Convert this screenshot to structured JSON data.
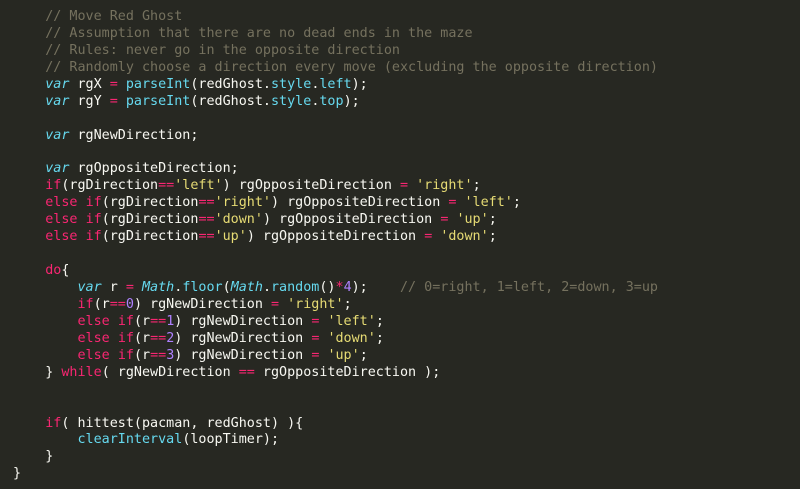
{
  "editor": {
    "theme": {
      "background": "#272822",
      "comment": "#75715e",
      "keyword": "#f92672",
      "storage": "#66d9ef",
      "string": "#e6db74",
      "number": "#ae81ff",
      "plain": "#f8f8f2"
    },
    "lines": [
      [
        {
          "t": "ws",
          "v": "    "
        },
        {
          "t": "comment",
          "v": "// Move Red Ghost"
        }
      ],
      [
        {
          "t": "ws",
          "v": "    "
        },
        {
          "t": "comment",
          "v": "// Assumption that there are no dead ends in the maze"
        }
      ],
      [
        {
          "t": "ws",
          "v": "    "
        },
        {
          "t": "comment",
          "v": "// Rules: never go in the opposite direction"
        }
      ],
      [
        {
          "t": "ws",
          "v": "    "
        },
        {
          "t": "comment",
          "v": "// Randomly choose a direction every move (excluding the opposite direction)"
        }
      ],
      [
        {
          "t": "ws",
          "v": "    "
        },
        {
          "t": "storage",
          "v": "var"
        },
        {
          "t": "plain",
          "v": " rgX "
        },
        {
          "t": "operator",
          "v": "="
        },
        {
          "t": "plain",
          "v": " "
        },
        {
          "t": "func",
          "v": "parseInt"
        },
        {
          "t": "plain",
          "v": "(redGhost."
        },
        {
          "t": "func",
          "v": "style"
        },
        {
          "t": "plain",
          "v": "."
        },
        {
          "t": "func",
          "v": "left"
        },
        {
          "t": "plain",
          "v": ");"
        }
      ],
      [
        {
          "t": "ws",
          "v": "    "
        },
        {
          "t": "storage",
          "v": "var"
        },
        {
          "t": "plain",
          "v": " rgY "
        },
        {
          "t": "operator",
          "v": "="
        },
        {
          "t": "plain",
          "v": " "
        },
        {
          "t": "func",
          "v": "parseInt"
        },
        {
          "t": "plain",
          "v": "(redGhost."
        },
        {
          "t": "func",
          "v": "style"
        },
        {
          "t": "plain",
          "v": "."
        },
        {
          "t": "func",
          "v": "top"
        },
        {
          "t": "plain",
          "v": ");"
        }
      ],
      [],
      [
        {
          "t": "ws",
          "v": "    "
        },
        {
          "t": "storage",
          "v": "var"
        },
        {
          "t": "plain",
          "v": " rgNewDirection;"
        }
      ],
      [],
      [
        {
          "t": "ws",
          "v": "    "
        },
        {
          "t": "storage",
          "v": "var"
        },
        {
          "t": "plain",
          "v": " rgOppositeDirection;"
        }
      ],
      [
        {
          "t": "ws",
          "v": "    "
        },
        {
          "t": "keyword",
          "v": "if"
        },
        {
          "t": "plain",
          "v": "(rgDirection"
        },
        {
          "t": "operator",
          "v": "=="
        },
        {
          "t": "string",
          "v": "'left'"
        },
        {
          "t": "plain",
          "v": ") rgOppositeDirection "
        },
        {
          "t": "operator",
          "v": "="
        },
        {
          "t": "plain",
          "v": " "
        },
        {
          "t": "string",
          "v": "'right'"
        },
        {
          "t": "plain",
          "v": ";"
        }
      ],
      [
        {
          "t": "ws",
          "v": "    "
        },
        {
          "t": "keyword",
          "v": "else"
        },
        {
          "t": "plain",
          "v": " "
        },
        {
          "t": "keyword",
          "v": "if"
        },
        {
          "t": "plain",
          "v": "(rgDirection"
        },
        {
          "t": "operator",
          "v": "=="
        },
        {
          "t": "string",
          "v": "'right'"
        },
        {
          "t": "plain",
          "v": ") rgOppositeDirection "
        },
        {
          "t": "operator",
          "v": "="
        },
        {
          "t": "plain",
          "v": " "
        },
        {
          "t": "string",
          "v": "'left'"
        },
        {
          "t": "plain",
          "v": ";"
        }
      ],
      [
        {
          "t": "ws",
          "v": "    "
        },
        {
          "t": "keyword",
          "v": "else"
        },
        {
          "t": "plain",
          "v": " "
        },
        {
          "t": "keyword",
          "v": "if"
        },
        {
          "t": "plain",
          "v": "(rgDirection"
        },
        {
          "t": "operator",
          "v": "=="
        },
        {
          "t": "string",
          "v": "'down'"
        },
        {
          "t": "plain",
          "v": ") rgOppositeDirection "
        },
        {
          "t": "operator",
          "v": "="
        },
        {
          "t": "plain",
          "v": " "
        },
        {
          "t": "string",
          "v": "'up'"
        },
        {
          "t": "plain",
          "v": ";"
        }
      ],
      [
        {
          "t": "ws",
          "v": "    "
        },
        {
          "t": "keyword",
          "v": "else"
        },
        {
          "t": "plain",
          "v": " "
        },
        {
          "t": "keyword",
          "v": "if"
        },
        {
          "t": "plain",
          "v": "(rgDirection"
        },
        {
          "t": "operator",
          "v": "=="
        },
        {
          "t": "string",
          "v": "'up'"
        },
        {
          "t": "plain",
          "v": ") rgOppositeDirection "
        },
        {
          "t": "operator",
          "v": "="
        },
        {
          "t": "plain",
          "v": " "
        },
        {
          "t": "string",
          "v": "'down'"
        },
        {
          "t": "plain",
          "v": ";"
        }
      ],
      [],
      [
        {
          "t": "ws",
          "v": "    "
        },
        {
          "t": "keyword",
          "v": "do"
        },
        {
          "t": "plain",
          "v": "{"
        }
      ],
      [
        {
          "t": "ws",
          "v": "        "
        },
        {
          "t": "storage",
          "v": "var"
        },
        {
          "t": "plain",
          "v": " r "
        },
        {
          "t": "operator",
          "v": "="
        },
        {
          "t": "plain",
          "v": " "
        },
        {
          "t": "builtin",
          "v": "Math"
        },
        {
          "t": "plain",
          "v": "."
        },
        {
          "t": "func",
          "v": "floor"
        },
        {
          "t": "plain",
          "v": "("
        },
        {
          "t": "builtin",
          "v": "Math"
        },
        {
          "t": "plain",
          "v": "."
        },
        {
          "t": "func",
          "v": "random"
        },
        {
          "t": "plain",
          "v": "()"
        },
        {
          "t": "operator",
          "v": "*"
        },
        {
          "t": "number",
          "v": "4"
        },
        {
          "t": "plain",
          "v": ");    "
        },
        {
          "t": "comment",
          "v": "// 0=right, 1=left, 2=down, 3=up"
        }
      ],
      [
        {
          "t": "ws",
          "v": "        "
        },
        {
          "t": "keyword",
          "v": "if"
        },
        {
          "t": "plain",
          "v": "(r"
        },
        {
          "t": "operator",
          "v": "=="
        },
        {
          "t": "number",
          "v": "0"
        },
        {
          "t": "plain",
          "v": ") rgNewDirection "
        },
        {
          "t": "operator",
          "v": "="
        },
        {
          "t": "plain",
          "v": " "
        },
        {
          "t": "string",
          "v": "'right'"
        },
        {
          "t": "plain",
          "v": ";"
        }
      ],
      [
        {
          "t": "ws",
          "v": "        "
        },
        {
          "t": "keyword",
          "v": "else"
        },
        {
          "t": "plain",
          "v": " "
        },
        {
          "t": "keyword",
          "v": "if"
        },
        {
          "t": "plain",
          "v": "(r"
        },
        {
          "t": "operator",
          "v": "=="
        },
        {
          "t": "number",
          "v": "1"
        },
        {
          "t": "plain",
          "v": ") rgNewDirection "
        },
        {
          "t": "operator",
          "v": "="
        },
        {
          "t": "plain",
          "v": " "
        },
        {
          "t": "string",
          "v": "'left'"
        },
        {
          "t": "plain",
          "v": ";"
        }
      ],
      [
        {
          "t": "ws",
          "v": "        "
        },
        {
          "t": "keyword",
          "v": "else"
        },
        {
          "t": "plain",
          "v": " "
        },
        {
          "t": "keyword",
          "v": "if"
        },
        {
          "t": "plain",
          "v": "(r"
        },
        {
          "t": "operator",
          "v": "=="
        },
        {
          "t": "number",
          "v": "2"
        },
        {
          "t": "plain",
          "v": ") rgNewDirection "
        },
        {
          "t": "operator",
          "v": "="
        },
        {
          "t": "plain",
          "v": " "
        },
        {
          "t": "string",
          "v": "'down'"
        },
        {
          "t": "plain",
          "v": ";"
        }
      ],
      [
        {
          "t": "ws",
          "v": "        "
        },
        {
          "t": "keyword",
          "v": "else"
        },
        {
          "t": "plain",
          "v": " "
        },
        {
          "t": "keyword",
          "v": "if"
        },
        {
          "t": "plain",
          "v": "(r"
        },
        {
          "t": "operator",
          "v": "=="
        },
        {
          "t": "number",
          "v": "3"
        },
        {
          "t": "plain",
          "v": ") rgNewDirection "
        },
        {
          "t": "operator",
          "v": "="
        },
        {
          "t": "plain",
          "v": " "
        },
        {
          "t": "string",
          "v": "'up'"
        },
        {
          "t": "plain",
          "v": ";"
        }
      ],
      [
        {
          "t": "ws",
          "v": "    "
        },
        {
          "t": "plain",
          "v": "} "
        },
        {
          "t": "keyword",
          "v": "while"
        },
        {
          "t": "plain",
          "v": "( rgNewDirection "
        },
        {
          "t": "operator",
          "v": "=="
        },
        {
          "t": "plain",
          "v": " rgOppositeDirection );"
        }
      ],
      [],
      [],
      [
        {
          "t": "ws",
          "v": "    "
        },
        {
          "t": "keyword",
          "v": "if"
        },
        {
          "t": "plain",
          "v": "( hittest(pacman, redGhost) ){"
        }
      ],
      [
        {
          "t": "ws",
          "v": "        "
        },
        {
          "t": "func",
          "v": "clearInterval"
        },
        {
          "t": "plain",
          "v": "(loopTimer);"
        }
      ],
      [
        {
          "t": "ws",
          "v": "    "
        },
        {
          "t": "plain",
          "v": "}"
        }
      ],
      [
        {
          "t": "plain",
          "v": "}"
        }
      ]
    ]
  }
}
